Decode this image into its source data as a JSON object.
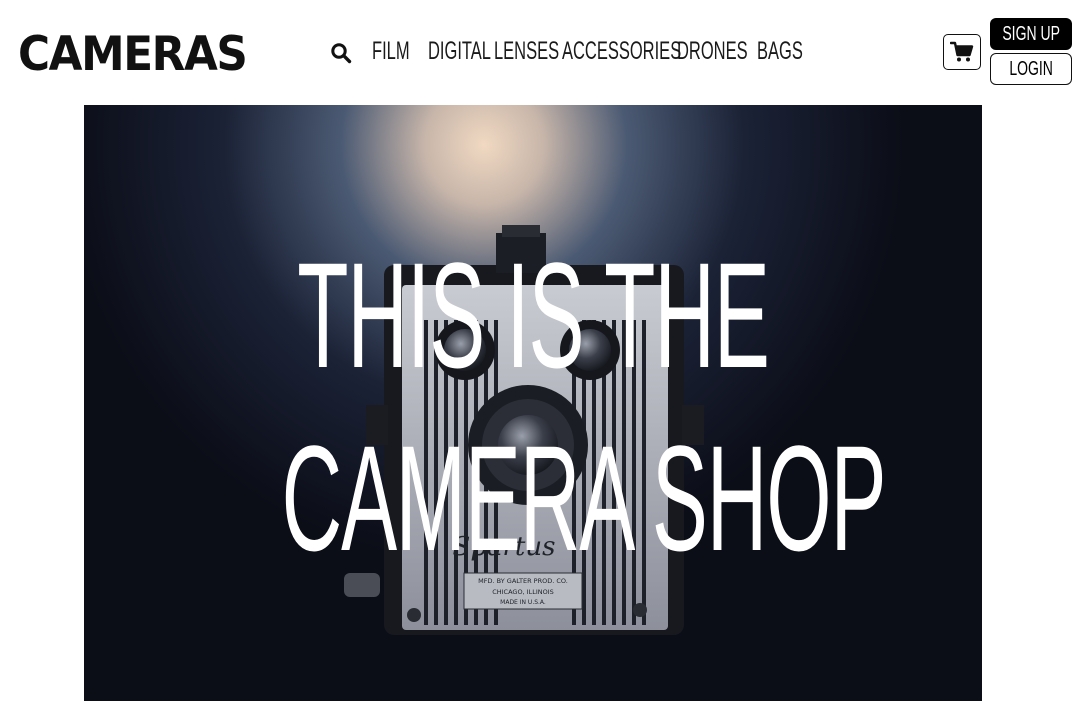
{
  "header": {
    "logo_text": "CAMERAS",
    "search_icon": "search-icon",
    "nav": {
      "film": "FILM",
      "digital": "DIGITAL",
      "lenses": "LENSES",
      "accessories": "ACCESSORIES",
      "drones": "DRONES",
      "bags": "BAGS"
    },
    "cart_icon": "cart-icon",
    "signup_label": "SIGN UP",
    "login_label": "LOGIN"
  },
  "hero": {
    "title_line1": "THIS IS THE",
    "title_line2": "CAMERA SHOP",
    "camera_plate": {
      "brand": "Spartus",
      "line1": "MFD. BY GALTER PROD. CO.",
      "line2": "CHICAGO, ILLINOIS",
      "line3": "MADE IN U.S.A."
    }
  },
  "colors": {
    "text": "#111111",
    "button_dark": "#000000",
    "hero_background": "#0b0d17",
    "hero_text": "#ffffff"
  }
}
